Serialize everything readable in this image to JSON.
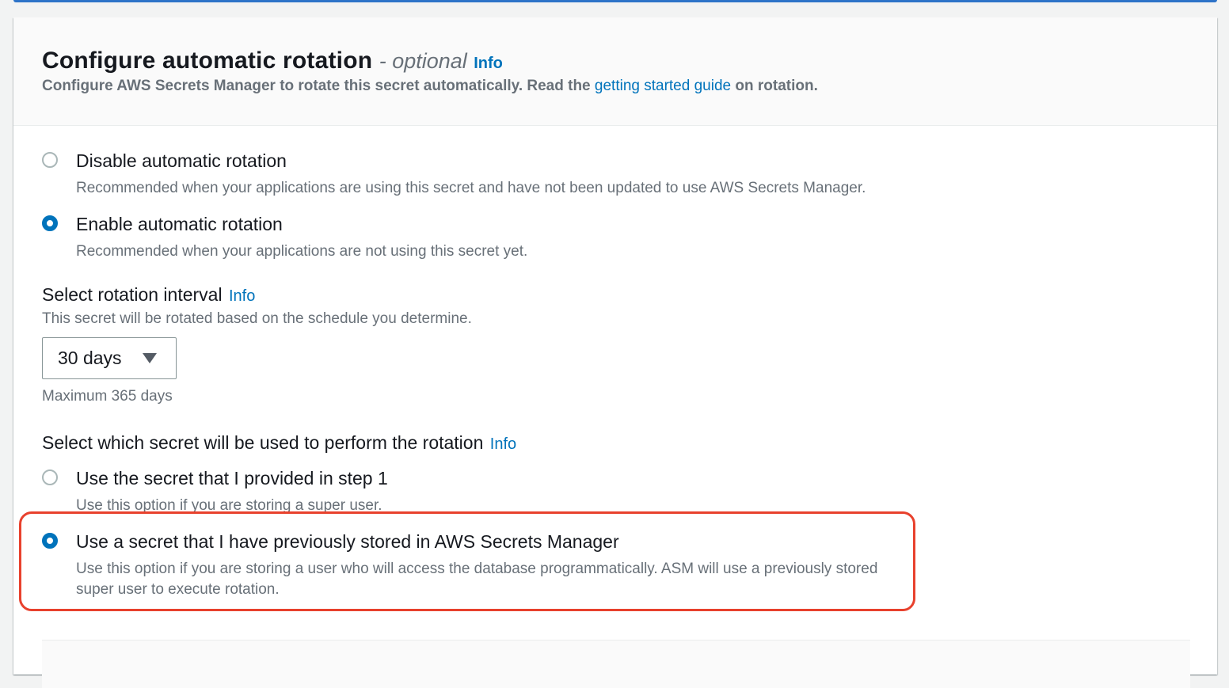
{
  "header": {
    "title": "Configure automatic rotation",
    "optional": "- optional",
    "info": "Info",
    "desc_prefix": "Configure AWS Secrets Manager to rotate this secret automatically. Read the",
    "desc_link": "getting started guide",
    "desc_suffix": "on rotation."
  },
  "rotation_options": [
    {
      "label": "Disable automatic rotation",
      "desc": "Recommended when your applications are using this secret and have not been updated to use AWS Secrets Manager.",
      "checked": false
    },
    {
      "label": "Enable automatic rotation",
      "desc": "Recommended when your applications are not using this secret yet.",
      "checked": true
    }
  ],
  "interval": {
    "label": "Select rotation interval",
    "info": "Info",
    "desc": "This secret will be rotated based on the schedule you determine.",
    "value": "30 days",
    "constraint": "Maximum 365 days"
  },
  "secret_choice": {
    "label": "Select which secret will be used to perform the rotation",
    "info": "Info",
    "options": [
      {
        "label": "Use the secret that I provided in step 1",
        "desc": "Use this option if you are storing a super user.",
        "checked": false
      },
      {
        "label": "Use a secret that I have previously stored in AWS Secrets Manager",
        "desc": "Use this option if you are storing a user who will access the database programmatically. ASM will use a previously stored super user to execute rotation.",
        "checked": true
      }
    ]
  },
  "colors": {
    "accent": "#0073bb",
    "highlight": "#e8412d"
  }
}
